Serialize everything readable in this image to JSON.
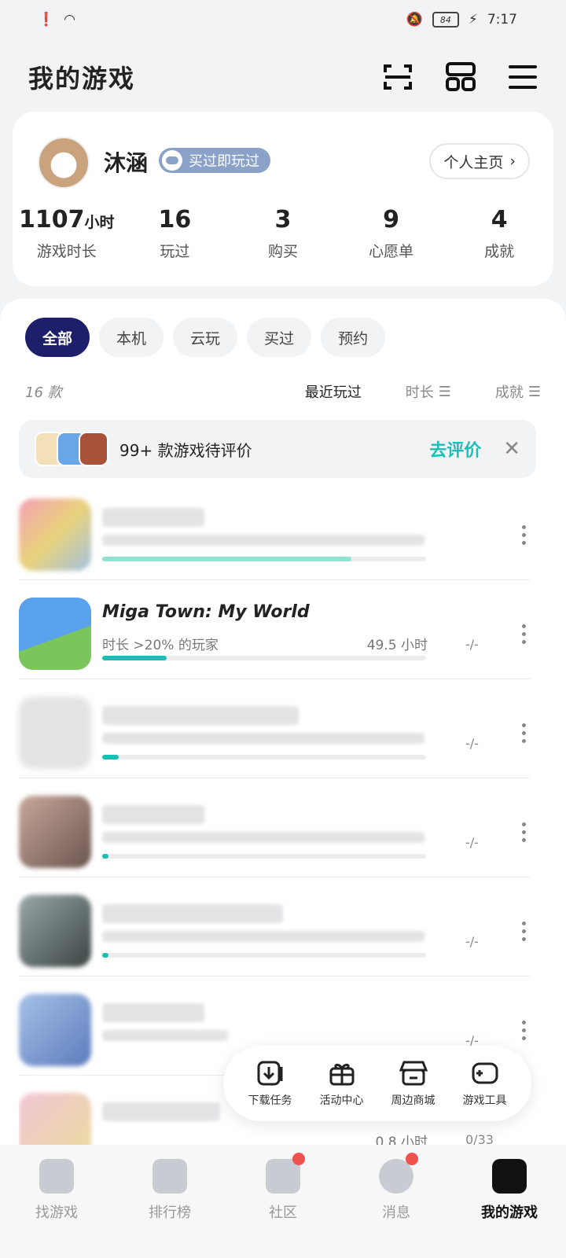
{
  "status_bar": {
    "battery": "84",
    "time": "7:17"
  },
  "header": {
    "title": "我的游戏"
  },
  "profile": {
    "username": "沐涵",
    "badge": "买过即玩过",
    "profile_button": "个人主页",
    "stats": [
      {
        "value": "1107",
        "unit": "小时",
        "label": "游戏时长"
      },
      {
        "value": "16",
        "unit": "",
        "label": "玩过"
      },
      {
        "value": "3",
        "unit": "",
        "label": "购买"
      },
      {
        "value": "9",
        "unit": "",
        "label": "心愿单"
      },
      {
        "value": "4",
        "unit": "",
        "label": "成就"
      }
    ]
  },
  "filters": [
    "全部",
    "本机",
    "云玩",
    "买过",
    "预约"
  ],
  "sort": {
    "count": "16 款",
    "recent": "最近玩过",
    "duration": "时长",
    "achievement": "成就"
  },
  "review_banner": {
    "text": "99+ 款游戏待评价",
    "action": "去评价"
  },
  "games": [
    {
      "title": "",
      "sub_left": "",
      "sub_right": "",
      "achv": "",
      "progress": 0.77
    },
    {
      "title": "Miga Town: My World",
      "sub_left": "时长 >20% 的玩家",
      "sub_right": "49.5 小时",
      "achv": "-/-",
      "progress": 0.2
    },
    {
      "title": "",
      "sub_left": "",
      "sub_right": "",
      "achv": "-/-",
      "progress": 0.05
    },
    {
      "title": "",
      "sub_left": "",
      "sub_right": "",
      "achv": "-/-",
      "progress": 0.02
    },
    {
      "title": "",
      "sub_left": "",
      "sub_right": "",
      "achv": "-/-",
      "progress": 0.02
    },
    {
      "title": "",
      "sub_left": "",
      "sub_right": "",
      "achv": "-/-",
      "progress": 0.0
    },
    {
      "title": "",
      "sub_left": "",
      "sub_right": "0.8 小时",
      "achv": "0/33",
      "progress": 0.0
    }
  ],
  "quick_tools": [
    "下载任务",
    "活动中心",
    "周边商城",
    "游戏工具"
  ],
  "bottom_nav": [
    "找游戏",
    "排行榜",
    "社区",
    "消息",
    "我的游戏"
  ]
}
